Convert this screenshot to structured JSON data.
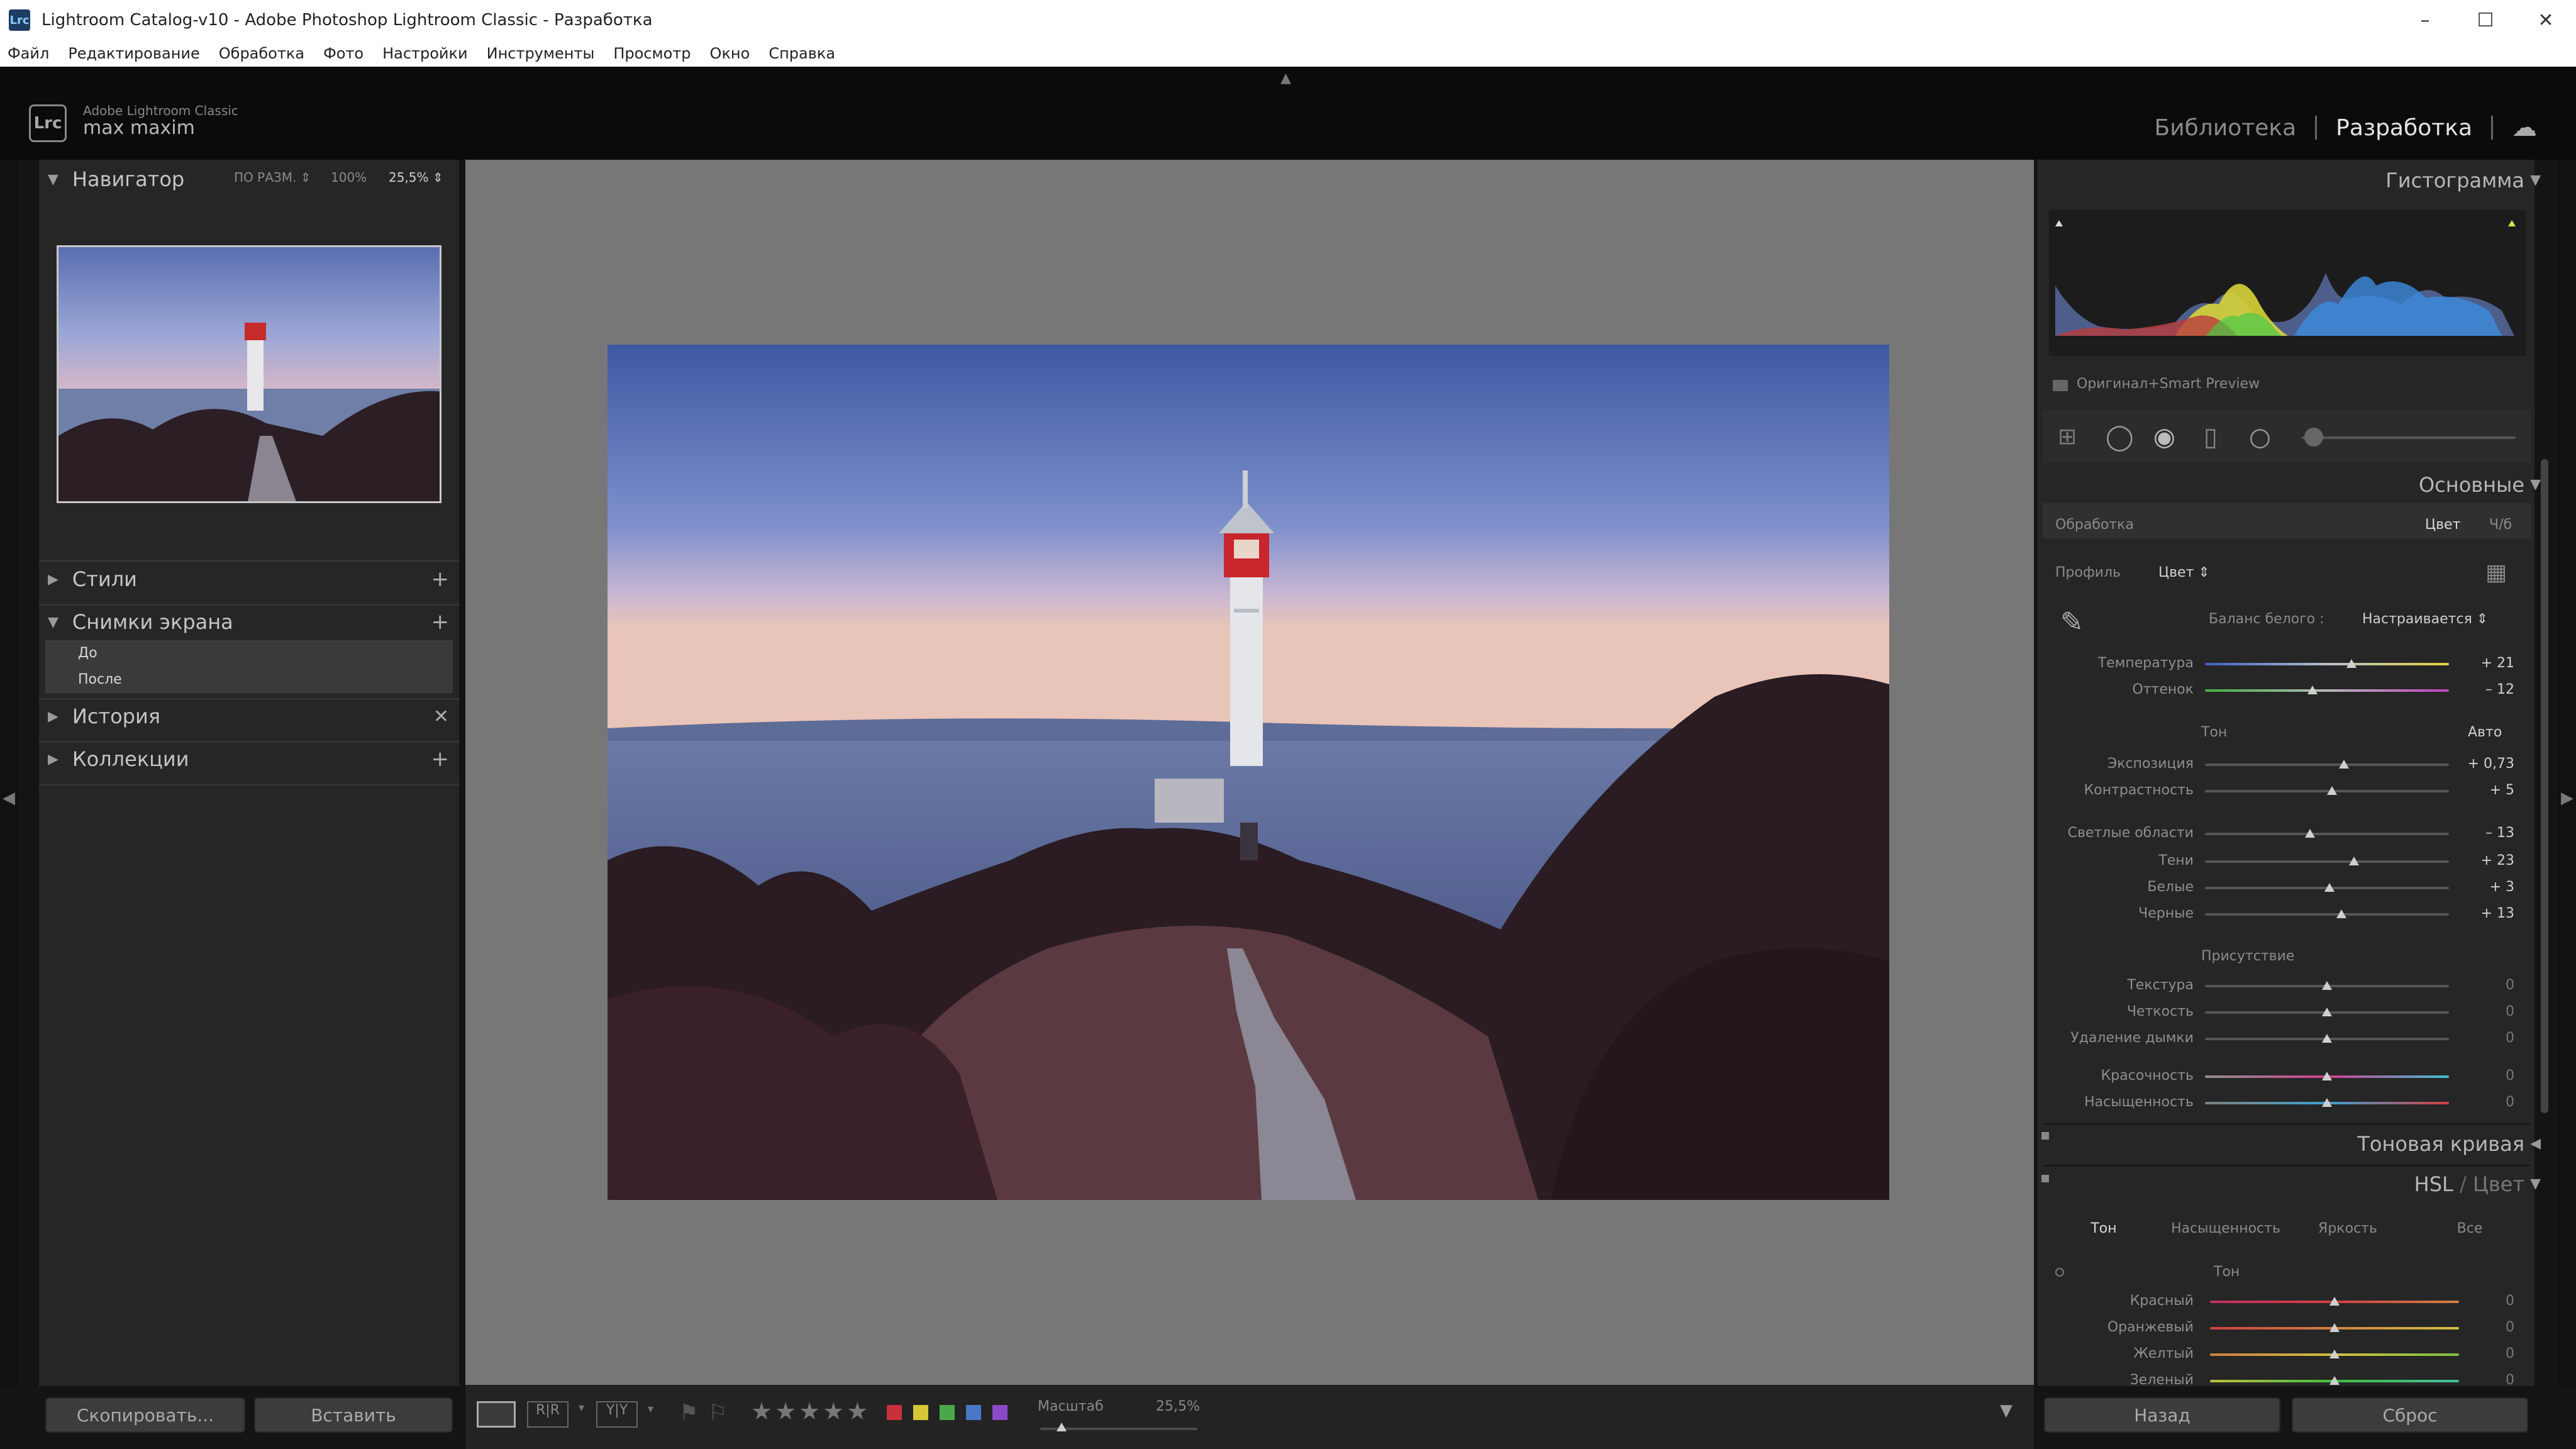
{
  "window": {
    "title": "Lightroom Catalog-v10 - Adobe Photoshop Lightroom Classic - Разработка",
    "icon_text": "Lrc",
    "minimize": "–",
    "maximize": "☐",
    "close": "✕"
  },
  "menu": [
    "Файл",
    "Редактирование",
    "Обработка",
    "Фото",
    "Настройки",
    "Инструменты",
    "Просмотр",
    "Окно",
    "Справка"
  ],
  "identity": {
    "logo": "Lrc",
    "brand_line1": "Adobe Lightroom Classic",
    "brand_line2": "max maxim",
    "module_library": "Библиотека",
    "module_develop": "Разработка"
  },
  "left_panel": {
    "navigator": {
      "title": "Навигатор",
      "opt_fit": "ПО РАЗМ.",
      "opt_100": "100%",
      "opt_zoom": "25,5%"
    },
    "presets": "Стили",
    "snapshots": {
      "title": "Снимки экрана",
      "items": [
        "До",
        "После"
      ]
    },
    "history": "История",
    "collections": "Коллекции",
    "copy_button": "Скопировать...",
    "paste_button": "Вставить"
  },
  "toolbar": {
    "zoom_label": "Масштаб",
    "zoom_value": "25,5%",
    "stars": "★★★★★",
    "color_labels": [
      "#c8303a",
      "#d6c636",
      "#4aa84a",
      "#4a78c8",
      "#8a4ac8"
    ]
  },
  "right_panel": {
    "histogram": {
      "title": "Гистограмма",
      "smart_preview": "Оригинал+Smart Preview"
    },
    "basic": {
      "title": "Основные",
      "treatment_label": "Обработка",
      "treatment_color": "Цвет",
      "treatment_bw": "Ч/б",
      "profile_label": "Профиль",
      "profile_value": "Цвет",
      "wb_label": "Баланс белого :",
      "wb_value": "Настраивается",
      "tone_label": "Тон",
      "auto_label": "Авто",
      "presence_label": "Присутствие",
      "sliders": [
        {
          "label": "Температура",
          "value": "+ 21",
          "pos": 0.6
        },
        {
          "label": "Оттенок",
          "value": "– 12",
          "pos": 0.44
        },
        {
          "label": "Экспозиция",
          "value": "+ 0,73",
          "pos": 0.57
        },
        {
          "label": "Контрастность",
          "value": "+ 5",
          "pos": 0.52
        },
        {
          "label": "Светлые области",
          "value": "– 13",
          "pos": 0.43
        },
        {
          "label": "Тени",
          "value": "+ 23",
          "pos": 0.61
        },
        {
          "label": "Белые",
          "value": "+ 3",
          "pos": 0.51
        },
        {
          "label": "Черные",
          "value": "+ 13",
          "pos": 0.56
        },
        {
          "label": "Текстура",
          "value": "0",
          "pos": 0.5
        },
        {
          "label": "Четкость",
          "value": "0",
          "pos": 0.5
        },
        {
          "label": "Удаление дымки",
          "value": "0",
          "pos": 0.5
        },
        {
          "label": "Красочность",
          "value": "0",
          "pos": 0.5
        },
        {
          "label": "Насыщенность",
          "value": "0",
          "pos": 0.5
        }
      ]
    },
    "tone_curve": "Тоновая кривая",
    "hsl": {
      "title": "HSL",
      "title_sep": "/",
      "title_alt": "Цвет",
      "tabs": [
        "Тон",
        "Насыщенность",
        "Яркость",
        "Все"
      ],
      "section": "Тон",
      "sliders": [
        {
          "label": "Красный",
          "value": "0",
          "pos": 0.5
        },
        {
          "label": "Оранжевый",
          "value": "0",
          "pos": 0.5
        },
        {
          "label": "Желтый",
          "value": "0",
          "pos": 0.5
        },
        {
          "label": "Зеленый",
          "value": "0",
          "pos": 0.5
        }
      ]
    },
    "back_button": "Назад",
    "reset_button": "Сброс"
  }
}
